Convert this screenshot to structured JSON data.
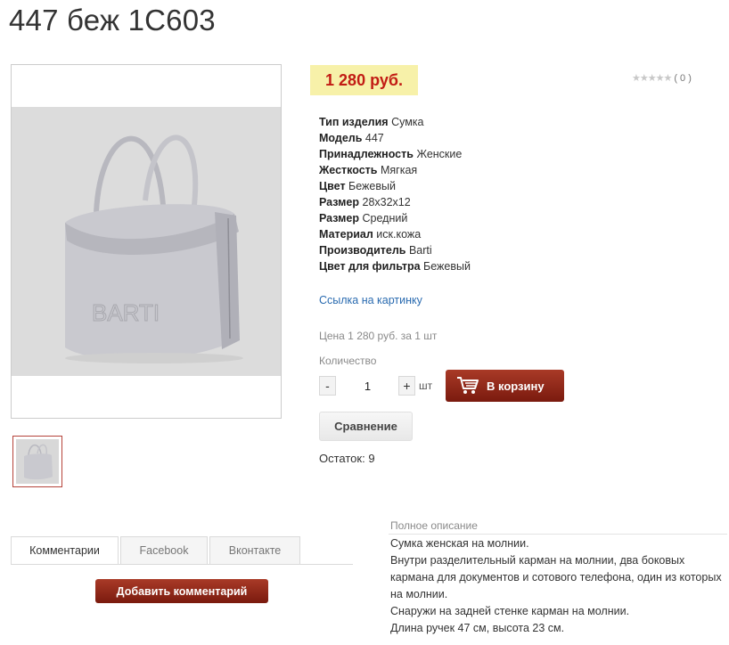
{
  "product": {
    "title": "447 беж 1С603",
    "price": "1 280 руб.",
    "rating_count": "( 0 )",
    "stars": "★★★★★"
  },
  "specs": [
    {
      "label": "Тип изделия",
      "value": "Сумка"
    },
    {
      "label": "Модель",
      "value": "447"
    },
    {
      "label": "Принадлежность",
      "value": "Женские"
    },
    {
      "label": "Жесткость",
      "value": "Мягкая"
    },
    {
      "label": "Цвет",
      "value": "Бежевый"
    },
    {
      "label": "Размер",
      "value": "28x32x12"
    },
    {
      "label": "Размер",
      "value": "Средний"
    },
    {
      "label": "Материал",
      "value": "иск.кожа"
    },
    {
      "label": "Производитель",
      "value": "Barti"
    },
    {
      "label": "Цвет для фильтра",
      "value": "Бежевый"
    }
  ],
  "image_link": "Ссылка на картинку",
  "purchase": {
    "unit_price": "Цена 1 280 руб. за 1 шт",
    "qty_label": "Количество",
    "minus": "-",
    "qty": "1",
    "plus": "+",
    "unit": "шт",
    "cart_label": "В корзину",
    "compare_label": "Сравнение",
    "stock": "Остаток: 9"
  },
  "tabs": [
    "Комментарии",
    "Facebook",
    "Вконтакте"
  ],
  "add_comment": "Добавить комментарий",
  "bag_logo": "BARTI",
  "description": {
    "title": "Полное описание",
    "lines": [
      "Сумка женская на молнии.",
      "Внутри разделительный карман на молнии, два боковых кармана для документов и сотового телефона, один из которых на молнии.",
      "Снаружи на задней стенке карман на молнии.",
      "Длина ручек 47 см, высота 23 см."
    ]
  },
  "colors": {
    "price_bg": "#f7f1a9",
    "price_text": "#c21c14",
    "button": "#8e2a1a",
    "link": "#2a6bb0"
  }
}
